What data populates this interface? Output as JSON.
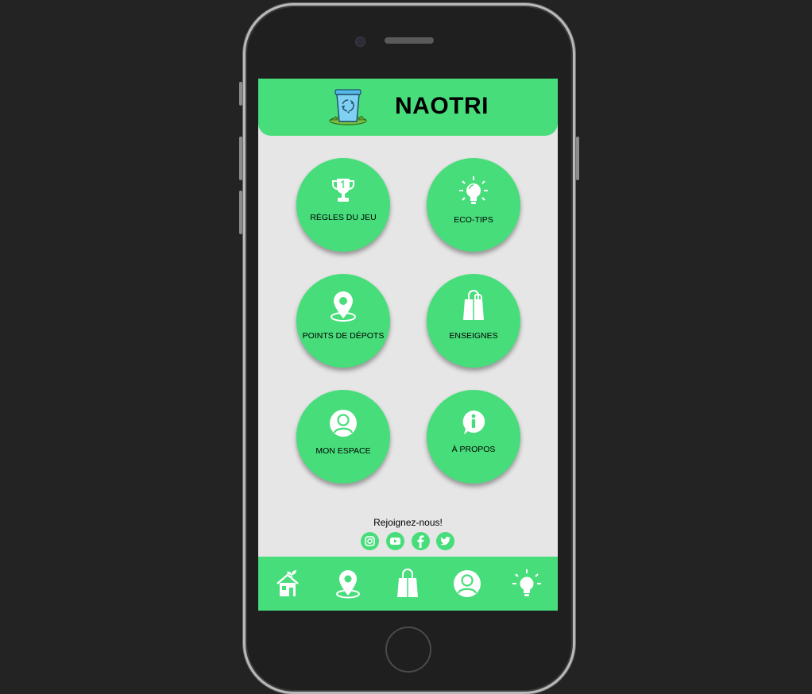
{
  "header": {
    "title": "NAOTRI",
    "logo_icon": "recycle-bin-icon"
  },
  "menu": {
    "tiles": [
      {
        "label": "RÈGLES DU JEU",
        "icon": "trophy-icon"
      },
      {
        "label": "ECO-TIPS",
        "icon": "lightbulb-icon"
      },
      {
        "label": "POINTS DE DÉPOTS",
        "icon": "map-pin-icon"
      },
      {
        "label": "ENSEIGNES",
        "icon": "shopping-bag-icon"
      },
      {
        "label": "MON ESPACE",
        "icon": "user-icon"
      },
      {
        "label": "À PROPOS",
        "icon": "info-icon"
      }
    ]
  },
  "footer": {
    "join_text": "Rejoignez-nous!",
    "social": [
      "instagram-icon",
      "youtube-icon",
      "facebook-icon",
      "twitter-icon"
    ]
  },
  "bottom_nav": {
    "items": [
      "home-icon",
      "map-pin-icon",
      "shopping-bag-icon",
      "user-icon",
      "lightbulb-icon"
    ]
  },
  "colors": {
    "accent": "#48dd7b",
    "screen_bg": "#e6e6e6",
    "device_bg": "#232323"
  }
}
